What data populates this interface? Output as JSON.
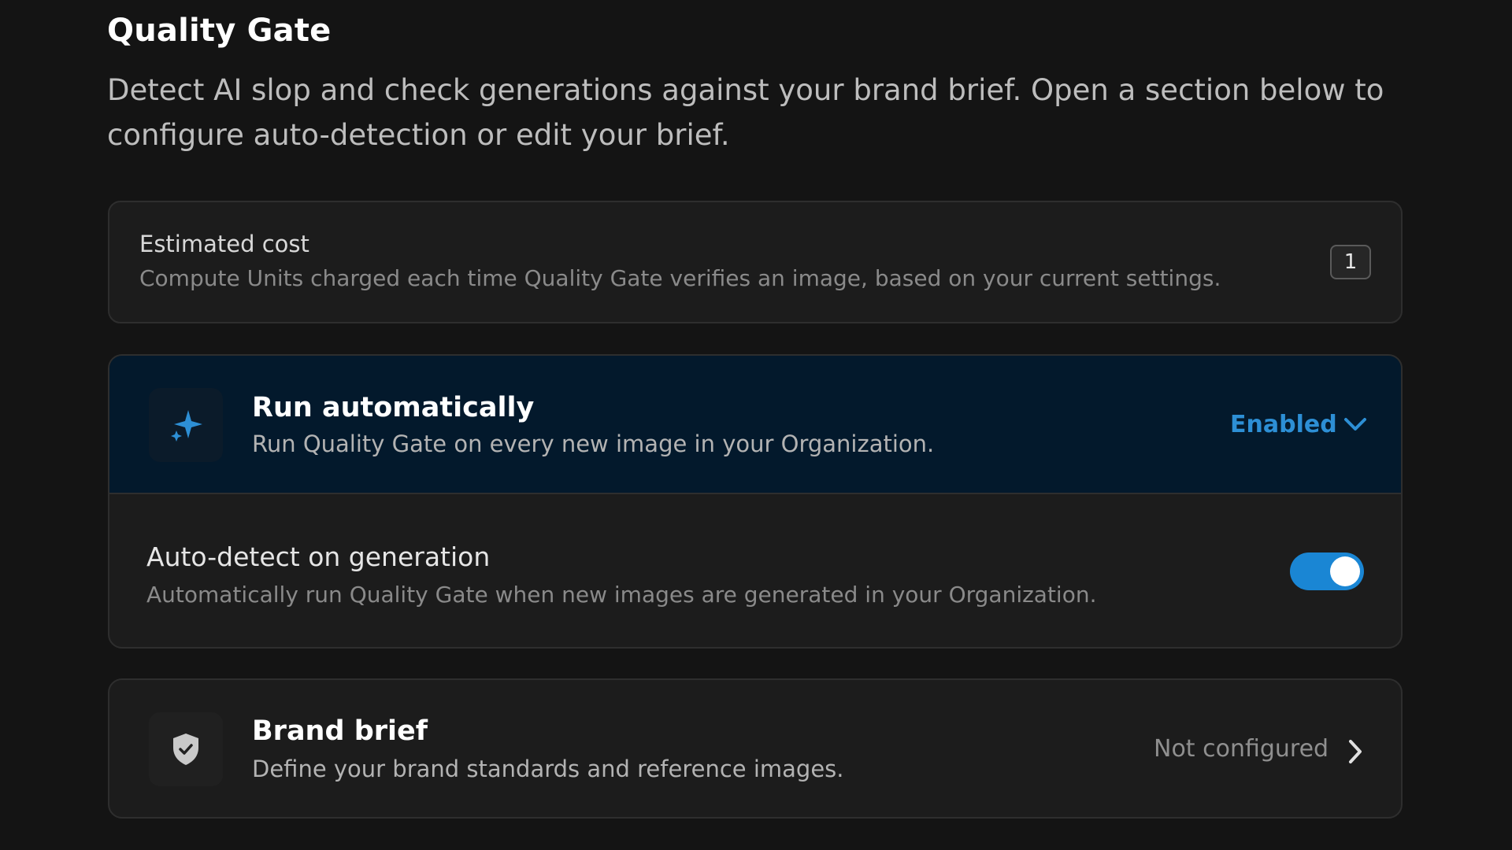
{
  "header": {
    "title": "Quality Gate",
    "description": "Detect AI slop and check generations against your brand brief. Open a section below to configure auto-detection or edit your brief."
  },
  "cost": {
    "title": "Estimated cost",
    "subtitle": "Compute Units charged each time Quality Gate verifies an image, based on your current settings.",
    "value": "1"
  },
  "run_automatically": {
    "icon": "sparkle-icon",
    "title": "Run automatically",
    "subtitle": "Run Quality Gate on every new image in your Organization.",
    "status": "Enabled",
    "status_color": "#2d8fd5",
    "expanded": true,
    "auto_detect": {
      "title": "Auto-detect on generation",
      "subtitle": "Automatically run Quality Gate when new images are generated in your Organization.",
      "enabled": true
    }
  },
  "brand_brief": {
    "icon": "shield-check-icon",
    "title": "Brand brief",
    "subtitle": "Define your brand standards and reference images.",
    "status": "Not configured"
  },
  "colors": {
    "background": "#141414",
    "card": "#1c1c1c",
    "active_header": "#03192c",
    "accent": "#1a86d4"
  }
}
